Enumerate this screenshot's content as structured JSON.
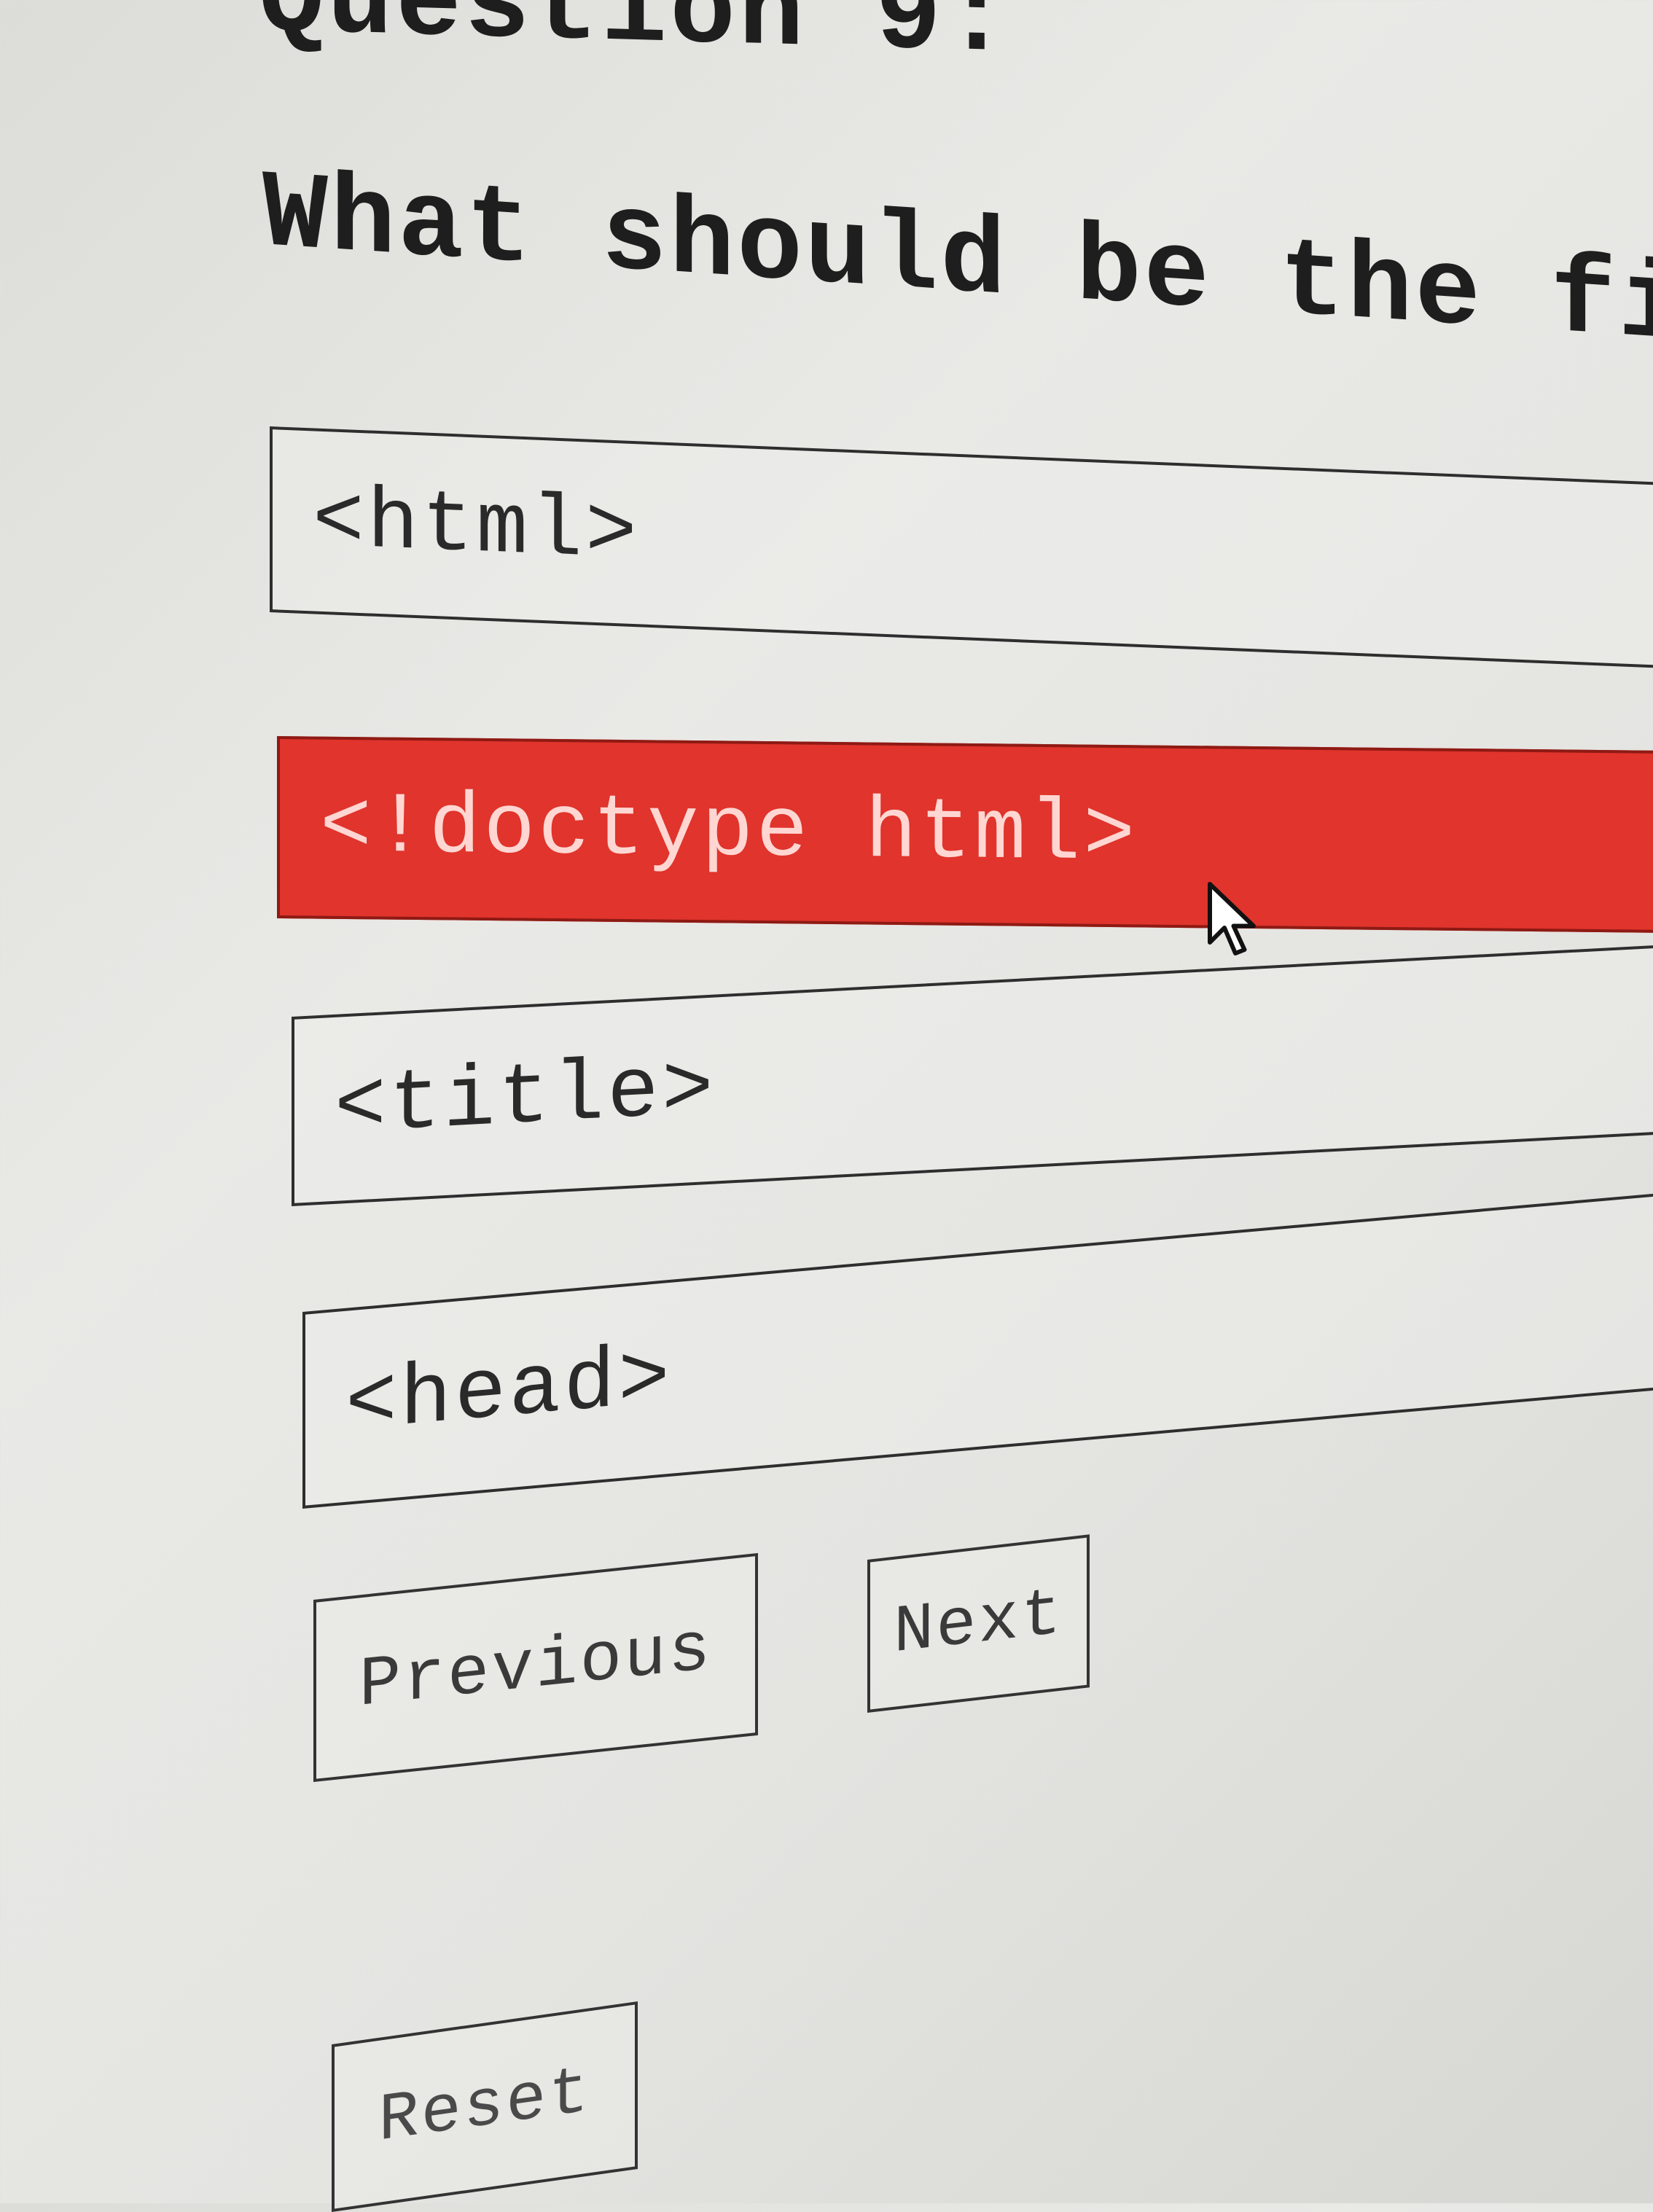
{
  "quiz": {
    "question_number": "Question 9:",
    "question_text": "What should be the firs",
    "options": [
      {
        "label": "<html>",
        "selected": false
      },
      {
        "label": "<!doctype html>",
        "selected": true
      },
      {
        "label": "<title>",
        "selected": false
      },
      {
        "label": "<head>",
        "selected": false
      }
    ]
  },
  "navigation": {
    "previous_label": "Previous",
    "next_label": "Next",
    "reset_label": "Reset"
  },
  "colors": {
    "selected_option": "#e0342c",
    "border": "#2e2e2e",
    "background": "#e6e6e3"
  },
  "icons": {
    "cursor": "mouse-pointer-icon"
  }
}
